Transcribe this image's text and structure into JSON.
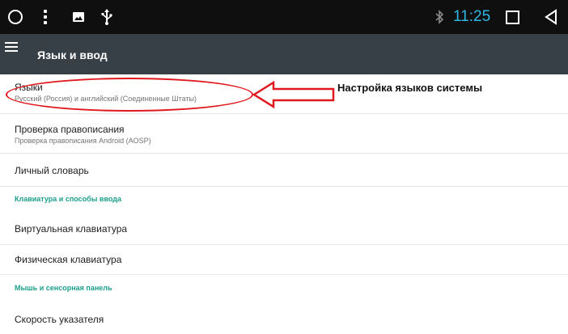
{
  "status_bar": {
    "time": "11:25",
    "icons": [
      "home-circle-icon",
      "overflow-dots-icon",
      "image-icon",
      "usb-icon",
      "bluetooth-icon",
      "recents-square-icon",
      "back-triangle-icon"
    ],
    "time_color": "#2fb7e2"
  },
  "toolbar": {
    "title": "Язык и ввод",
    "menu_icon": "hamburger-menu-icon",
    "background": "#374047"
  },
  "list": {
    "languages": {
      "title": "Языки",
      "subtitle": "Русский (Россия) и английский (Соединенные Штаты)"
    },
    "spellcheck": {
      "title": "Проверка правописания",
      "subtitle": "Проверка правописания Android (AOSP)"
    },
    "dictionary": {
      "title": "Личный словарь"
    },
    "section_keyboard": "Клавиатура и способы ввода",
    "virtual_keyboard": {
      "title": "Виртуальная клавиатура"
    },
    "physical_keyboard": {
      "title": "Физическая клавиатура"
    },
    "section_mouse": "Мышь и сенсорная панель",
    "pointer_speed": {
      "title": "Скорость указателя"
    }
  },
  "annotation": {
    "text": "Настройка языков системы",
    "color": "#e0191f"
  },
  "accent_color": "#1c9e8c"
}
